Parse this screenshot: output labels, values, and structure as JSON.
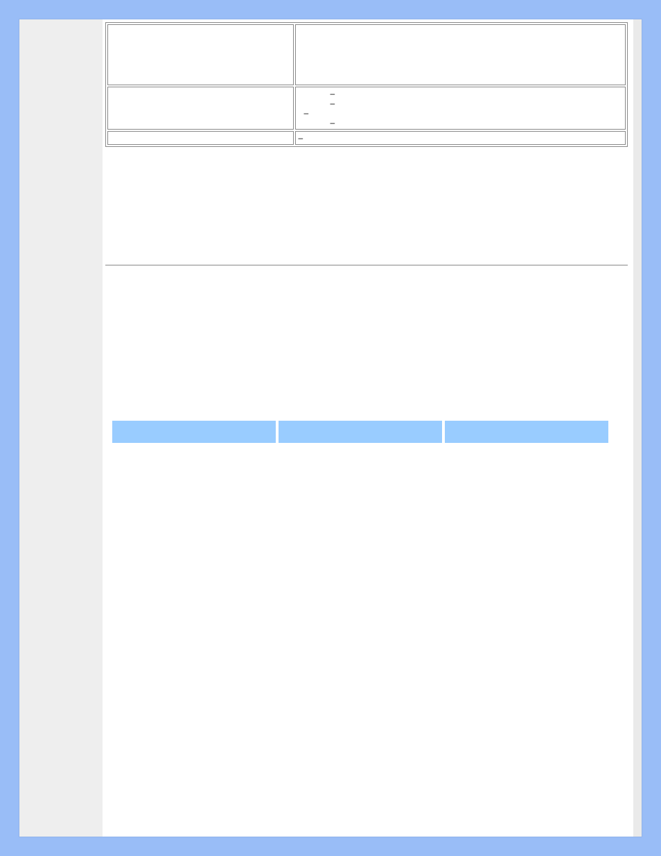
{
  "rows": [
    {
      "label": "",
      "value": ""
    },
    {
      "label": "",
      "items": [
        "",
        "",
        "",
        ""
      ]
    },
    {
      "label": "",
      "value": "–"
    }
  ],
  "tabs": [
    "",
    "",
    ""
  ]
}
